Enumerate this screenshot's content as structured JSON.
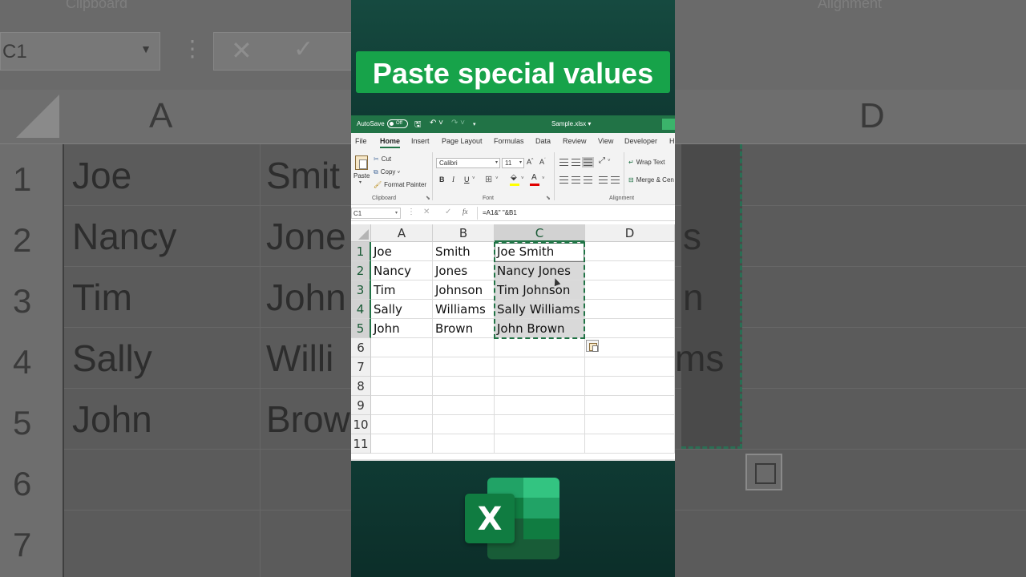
{
  "overlay": {
    "title": "Paste special values"
  },
  "background_zoom": {
    "ribbon_labels": [
      "Clipboard",
      "Alignment"
    ],
    "name_box": "C1",
    "columns": [
      "A",
      "D"
    ],
    "rows": [
      "1",
      "2",
      "3",
      "4",
      "5",
      "6",
      "7"
    ],
    "col_a": [
      "Joe",
      "Nancy",
      "Tim",
      "Sally",
      "John"
    ],
    "col_b_partial": [
      "Smit",
      "Jone",
      "John",
      "Willi",
      "Brow"
    ],
    "col_c_partial": [
      "s",
      "n",
      "ms"
    ]
  },
  "excel": {
    "titlebar": {
      "autosave_label": "AutoSave",
      "autosave_state": "Off",
      "filename": "Sample.xlsx",
      "save_icon": "save-icon",
      "undo_icon": "undo-icon",
      "redo_icon": "redo-icon"
    },
    "tabs": [
      "File",
      "Home",
      "Insert",
      "Page Layout",
      "Formulas",
      "Data",
      "Review",
      "View",
      "Developer",
      "H"
    ],
    "active_tab": "Home",
    "ribbon": {
      "clipboard": {
        "paste_label": "Paste",
        "cut_label": "Cut",
        "copy_label": "Copy",
        "format_painter_label": "Format Painter",
        "group_label": "Clipboard"
      },
      "font": {
        "font_name": "Calibri",
        "font_size": "11",
        "bold": "B",
        "italic": "I",
        "underline": "U",
        "grow": "A",
        "shrink": "A",
        "group_label": "Font"
      },
      "alignment": {
        "wrap_text_label": "Wrap Text",
        "merge_label": "Merge & Cen",
        "group_label": "Alignment"
      }
    },
    "formula_bar": {
      "name_box": "C1",
      "fx_label": "fx",
      "formula": "=A1&\" \"&B1"
    },
    "grid": {
      "columns": [
        "A",
        "B",
        "C",
        "D"
      ],
      "selected_column": "C",
      "row_numbers": [
        "1",
        "2",
        "3",
        "4",
        "5",
        "6",
        "7",
        "8",
        "9",
        "10",
        "11"
      ],
      "rows": [
        [
          "Joe",
          "Smith",
          "Joe Smith",
          ""
        ],
        [
          "Nancy",
          "Jones",
          "Nancy Jones",
          ""
        ],
        [
          "Tim",
          "Johnson",
          "Tim Johnson",
          ""
        ],
        [
          "Sally",
          "Williams",
          "Sally Williams",
          ""
        ],
        [
          "John",
          "Brown",
          "John Brown",
          ""
        ]
      ],
      "selection_range": "C1:C5"
    }
  },
  "logo": {
    "letter": "X",
    "brand_green": "#107c41"
  },
  "colors": {
    "excel_green": "#217346",
    "title_banner": "#17a34a",
    "selection_shade": "#d9d9d9"
  }
}
